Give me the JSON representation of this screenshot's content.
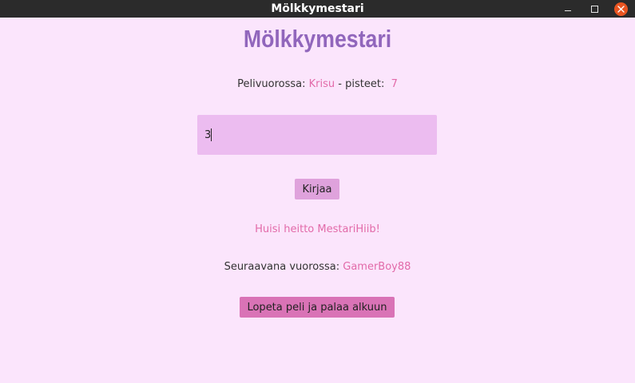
{
  "window": {
    "title": "Mölkkymestari"
  },
  "app": {
    "title": "Mölkkymestari",
    "current_turn_label": "Pelivuorossa:",
    "current_player": "Krisu",
    "points_separator": "- pisteet:",
    "current_points": "7",
    "score_input_value": "3",
    "record_button_label": "Kirjaa",
    "throw_message": "Huisi heitto MestariHiib!",
    "next_turn_label": "Seuraavana vuorossa:",
    "next_player": "GamerBoy88",
    "quit_button_label": "Lopeta peli ja palaa alkuun"
  },
  "colors": {
    "background": "#fbe5fc",
    "title": "#9166bc",
    "accent": "#e26aa9",
    "input_bg": "#ecbcf0",
    "record_button": "#dfa2dc",
    "quit_button": "#d973b6"
  },
  "icons": {
    "minimize": "minimize-icon",
    "maximize": "maximize-icon",
    "close": "close-icon"
  }
}
